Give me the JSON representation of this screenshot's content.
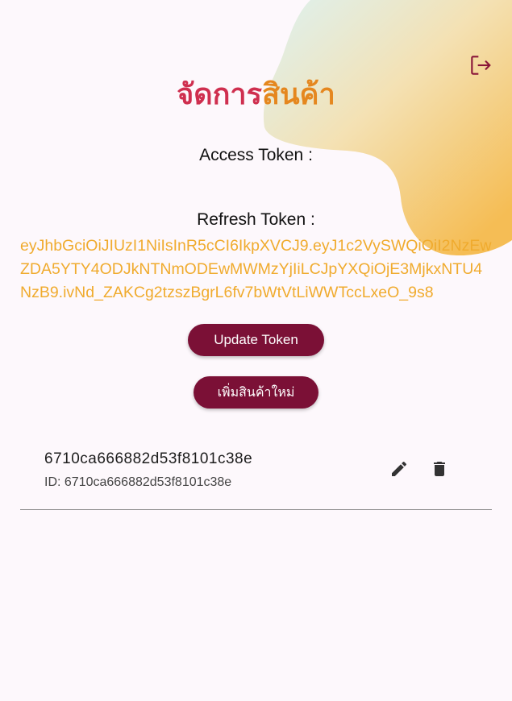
{
  "colors": {
    "primary": "#7b1036",
    "title_part1": "#cf2f4f",
    "title_part2": "#e5871f",
    "token_text": "#f0ab2e",
    "blob_gold": "#f4bf55",
    "background": "#fdf8fc"
  },
  "header": {
    "title_part1": "จัดการ",
    "title_part2": "สินค้า",
    "logout_icon": "logout-icon"
  },
  "tokens": {
    "access_label": "Access Token :",
    "access_value": "",
    "refresh_label": "Refresh Token :",
    "refresh_value": "eyJhbGciOiJIUzI1NiIsInR5cCI6IkpXVCJ9.eyJ1c2VySWQiOiI2NzEwZDA5YTY4ODJkNTNmODEwMWMzYjIiLCJpYXQiOjE3MjkxNTU4NzB9.ivNd_ZAKCg2tzszBgrL6fv7bWtVtLiWWTccLxeO_9s8"
  },
  "actions": {
    "update_label": "Update Token",
    "add_label": "เพิ่มสินค้าใหม่"
  },
  "products": [
    {
      "name": "6710ca666882d53f8101c38e",
      "id_text": "ID: 6710ca666882d53f8101c38e",
      "edit_icon": "pencil-icon",
      "delete_icon": "trash-icon"
    }
  ]
}
